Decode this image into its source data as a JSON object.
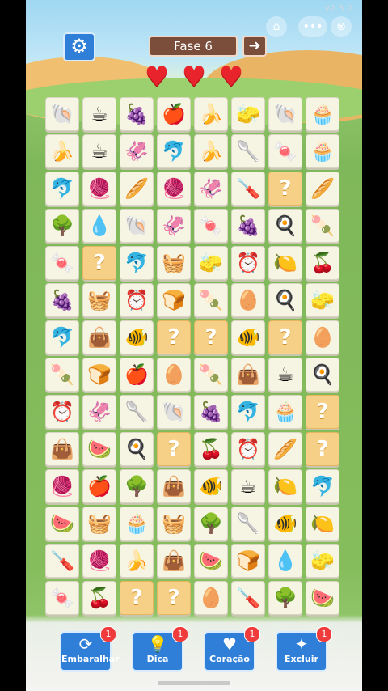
{
  "version": "v2.3.2",
  "header": {
    "level_label": "Fase 6",
    "lives": 3,
    "heart_color": "#e8232b",
    "accent_color": "#2f7fd8",
    "level_panel_color": "#7b4e3c"
  },
  "icons": {
    "settings": "gear-icon",
    "next_level": "arrow-right-icon",
    "home": "home-icon",
    "more": "more-icon",
    "close": "close-icon"
  },
  "board": {
    "columns": 8,
    "rows": 14,
    "tiles": [
      [
        "shell",
        "cup",
        "grapes",
        "apple",
        "banana",
        "sponge",
        "shell",
        "cupcake"
      ],
      [
        "banana",
        "cup",
        "squid",
        "dolphin",
        "banana",
        "spoon",
        "candy",
        "cupcake"
      ],
      [
        "dolphin",
        "yarn",
        "bread",
        "yarn",
        "squid",
        "screwdriver",
        "?",
        "bread"
      ],
      [
        "tree",
        "drop",
        "shell",
        "squid",
        "candy",
        "grapes",
        "pan",
        "popsicle"
      ],
      [
        "candy",
        "?",
        "dolphin",
        "basket",
        "sponge",
        "clock",
        "lemon",
        "cherries"
      ],
      [
        "grapes",
        "basket",
        "clock",
        "toast",
        "popsicle",
        "egg",
        "pan",
        "sponge"
      ],
      [
        "dolphin",
        "bag",
        "fish",
        "?",
        "?",
        "fish",
        "?",
        "egg"
      ],
      [
        "popsicle",
        "toast",
        "apple",
        "egg",
        "popsicle",
        "bag",
        "cup",
        "pan"
      ],
      [
        "clock",
        "squid",
        "spoon",
        "shell",
        "grapes",
        "dolphin",
        "cupcake",
        "?"
      ],
      [
        "bag",
        "watermelon",
        "pan",
        "?",
        "cherries",
        "clock",
        "bread",
        "?"
      ],
      [
        "yarn",
        "apple",
        "tree",
        "bag",
        "fish",
        "cup",
        "lemon",
        "dolphin"
      ],
      [
        "watermelon",
        "basket",
        "cupcake",
        "basket",
        "tree",
        "spoon",
        "fish",
        "lemon"
      ],
      [
        "screwdriver",
        "yarn",
        "banana",
        "bag",
        "watermelon",
        "toast",
        "drop",
        "sponge"
      ],
      [
        "candy",
        "cherries",
        "?",
        "?",
        "egg",
        "screwdriver",
        "tree",
        "watermelon"
      ]
    ]
  },
  "powerups": [
    {
      "label": "Embaralhar",
      "icon": "shuffle-icon",
      "count": "1"
    },
    {
      "label": "Dica",
      "icon": "lightbulb-icon",
      "count": "1"
    },
    {
      "label": "Coração",
      "icon": "heart-plus-icon",
      "count": "1"
    },
    {
      "label": "Excluir",
      "icon": "magic-wand-icon",
      "count": "1"
    }
  ]
}
